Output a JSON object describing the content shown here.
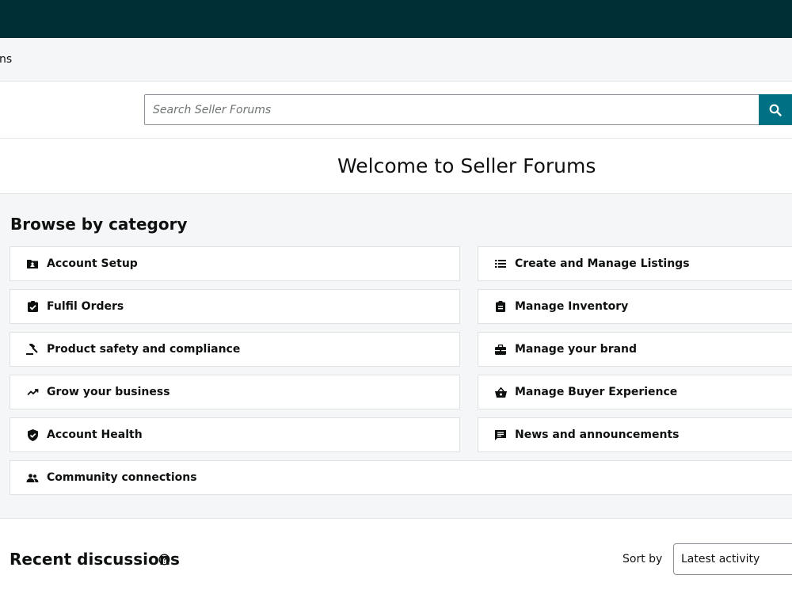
{
  "header": {
    "subnav_text": "ns"
  },
  "search": {
    "placeholder": "Search Seller Forums",
    "button_icon": "search-icon"
  },
  "welcome": {
    "title": "Welcome to Seller Forums"
  },
  "browse": {
    "title": "Browse by category",
    "categories": [
      {
        "label": "Account Setup",
        "icon": "account-setup-icon"
      },
      {
        "label": "Create and Manage Listings",
        "icon": "list-icon"
      },
      {
        "label": "Fulfil Orders",
        "icon": "clipboard-check-icon"
      },
      {
        "label": "Manage Inventory",
        "icon": "clipboard-icon"
      },
      {
        "label": "Product safety and compliance",
        "icon": "gavel-icon"
      },
      {
        "label": "Manage your brand",
        "icon": "briefcase-icon"
      },
      {
        "label": "Grow your business",
        "icon": "trending-up-icon"
      },
      {
        "label": "Manage Buyer Experience",
        "icon": "shopping-basket-icon"
      },
      {
        "label": "Account Health",
        "icon": "shield-icon"
      },
      {
        "label": "News and announcements",
        "icon": "announcement-icon"
      },
      {
        "label": "Community connections",
        "icon": "people-icon"
      }
    ]
  },
  "recent": {
    "title": "Recent discussions",
    "sort_label": "Sort by",
    "sort_value": "Latest activity"
  },
  "colors": {
    "topbar": "#002f36",
    "accent": "#007185",
    "panel": "#f5f6f8"
  }
}
